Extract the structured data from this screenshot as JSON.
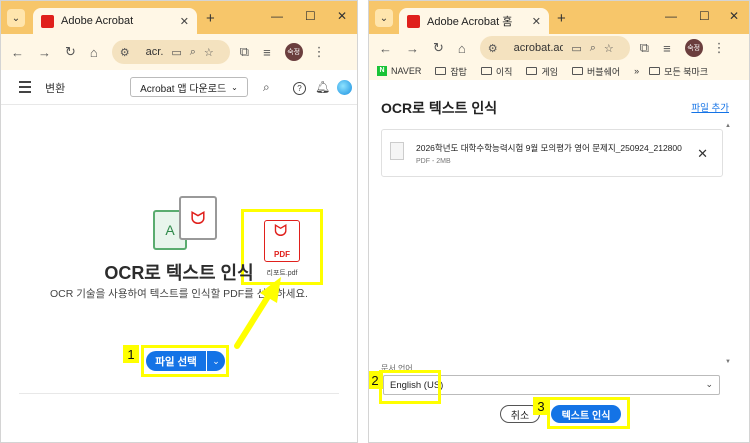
{
  "left_window": {
    "tab_title": "Adobe Acrobat",
    "address": "acr...",
    "app_header": {
      "menu_label": "변환",
      "download_button": "Acrobat 앱 다운로드"
    },
    "hero": {
      "title": "OCR로 텍스트 인식",
      "description": "OCR 기술을 사용하여 텍스트를 인식할 PDF를 선택하세요."
    },
    "pdf_file": {
      "label": "PDF",
      "filename": "리포트.pdf"
    },
    "select_file_button": "파일 선택",
    "step_badge": "1"
  },
  "right_window": {
    "tab_title": "Adobe Acrobat 홈",
    "address": "acrobat.ado...",
    "bookmarks": [
      "NAVER",
      "잡탑",
      "이직",
      "게임",
      "버블쉐어",
      "모든 북마크"
    ],
    "dialog": {
      "title": "OCR로 텍스트 인식",
      "add_file": "파일 추가",
      "file": {
        "name": "2026학년도 대학수학능력시험 9월 모의평가 영어 문제지_250924_212800",
        "meta": "PDF - 2MB"
      },
      "language_label": "문서 언어",
      "language_value": "English (US)",
      "cancel_button": "취소",
      "ocr_button": "텍스트 인식"
    },
    "step_badges": [
      "2",
      "3"
    ]
  },
  "colors": {
    "accent": "#1473e6",
    "highlight": "#ffff00",
    "titlebar": "#f7c66a",
    "toolbar": "#fff7e6",
    "acrobat_red": "#e0201c"
  }
}
